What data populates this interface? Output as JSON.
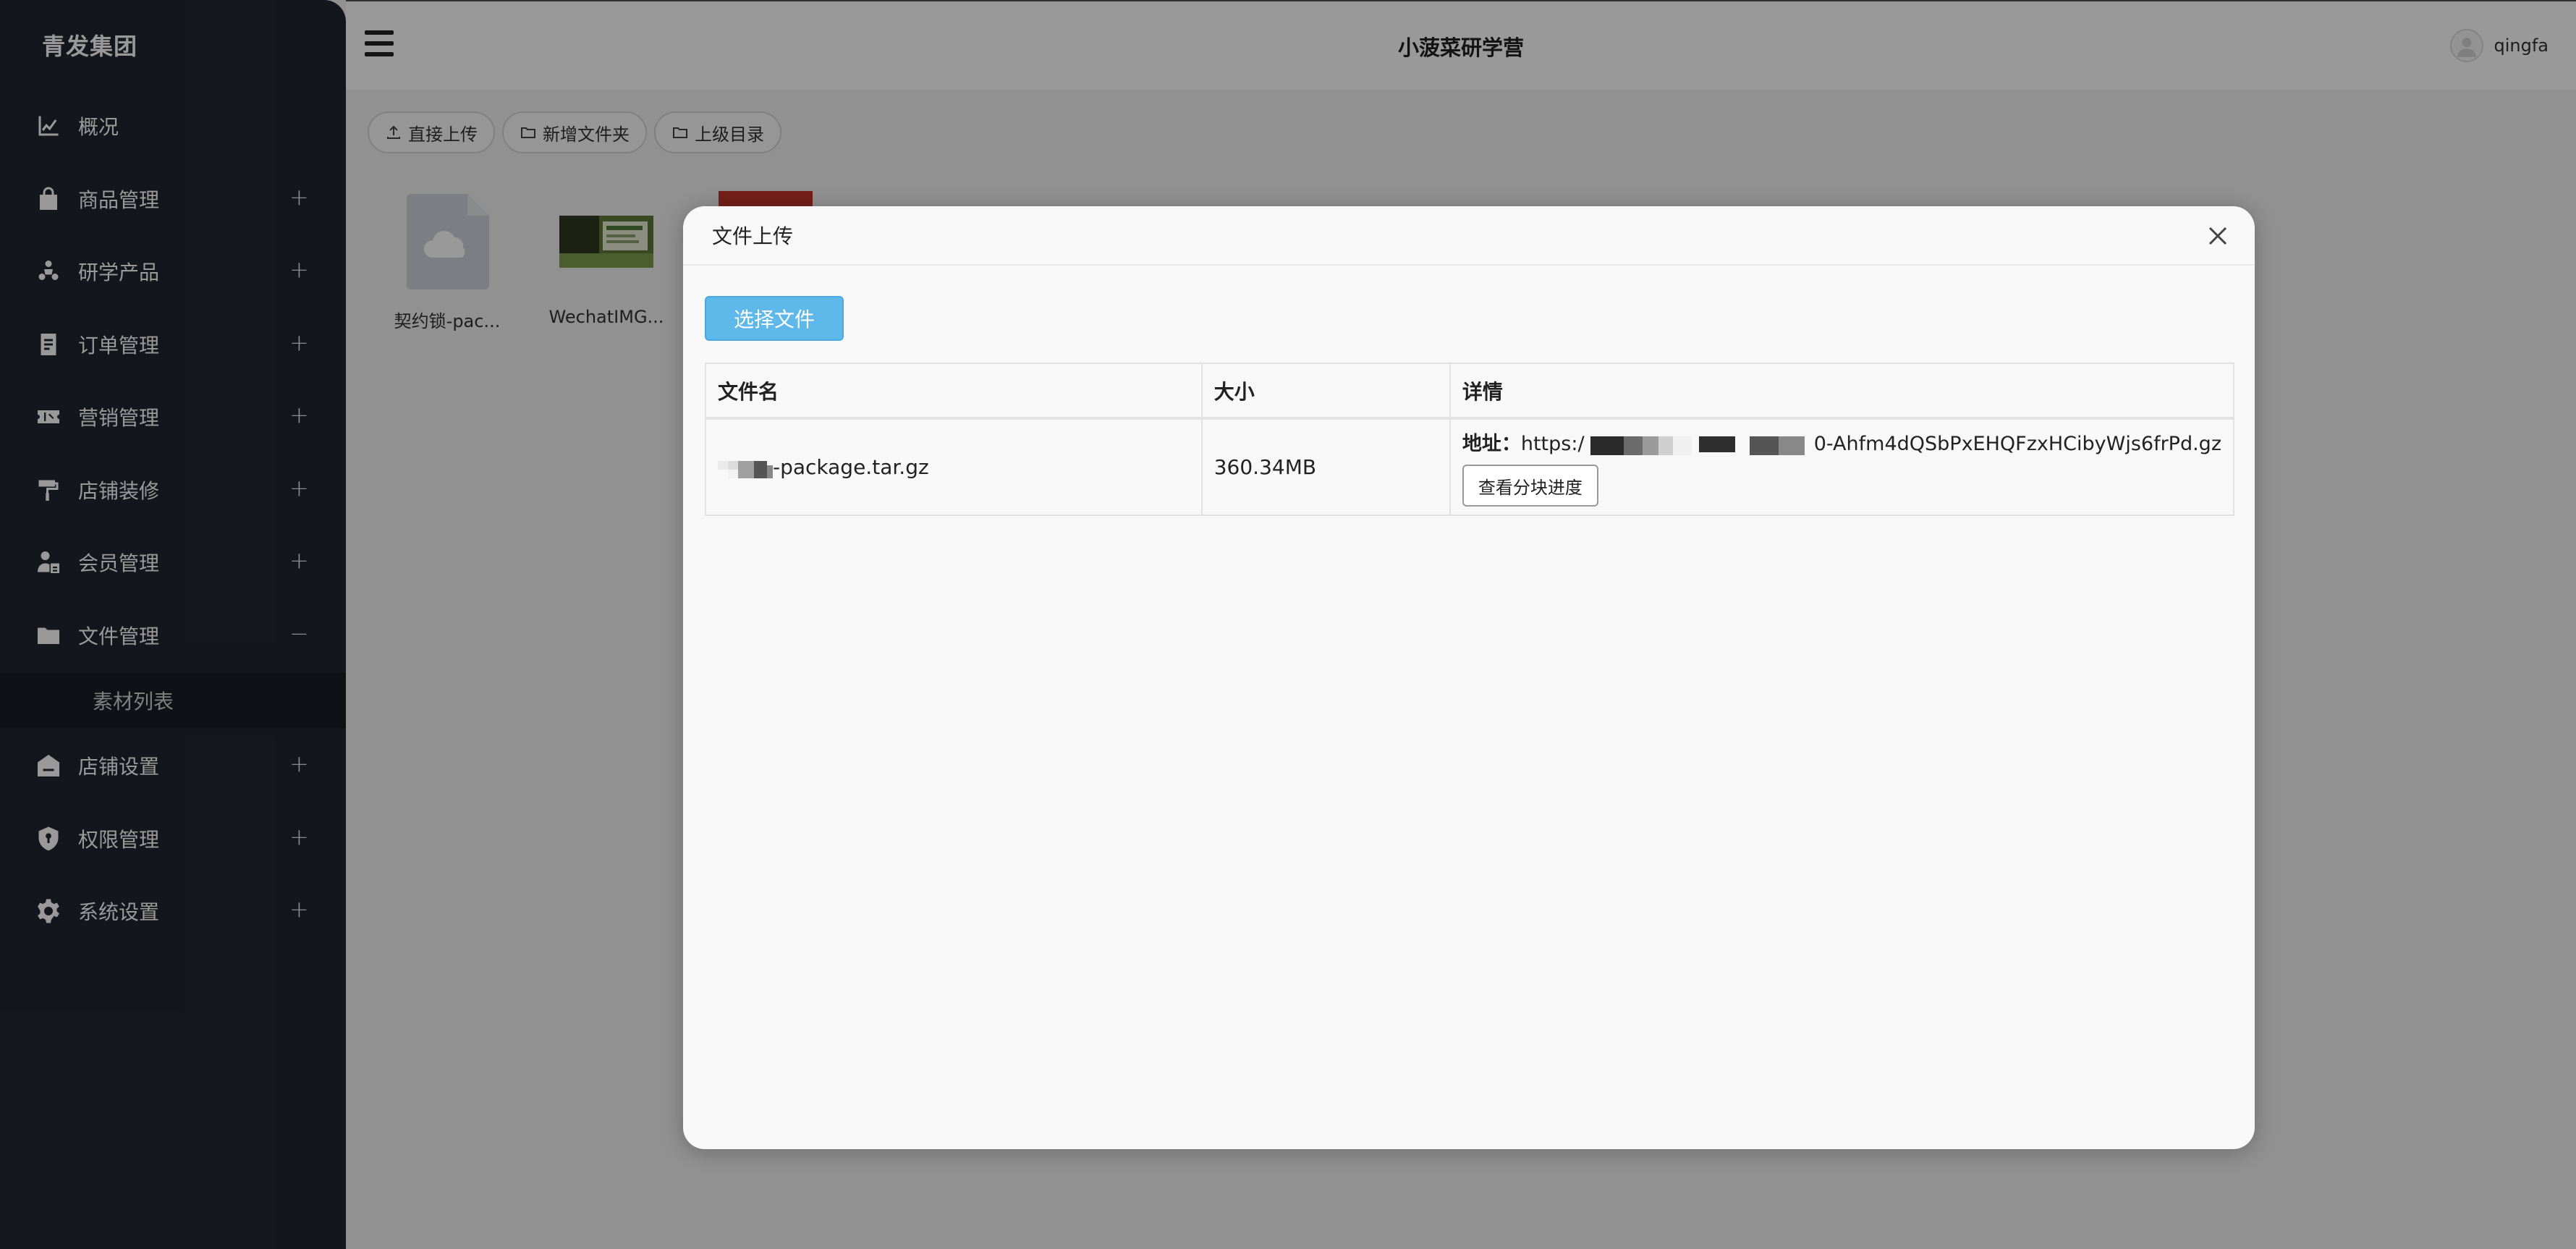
{
  "sidebar": {
    "brand": "青发集团",
    "items": [
      {
        "label": "概况",
        "toggle": ""
      },
      {
        "label": "商品管理",
        "toggle": "+"
      },
      {
        "label": "研学产品",
        "toggle": "+"
      },
      {
        "label": "订单管理",
        "toggle": "+"
      },
      {
        "label": "营销管理",
        "toggle": "+"
      },
      {
        "label": "店铺装修",
        "toggle": "+"
      },
      {
        "label": "会员管理",
        "toggle": "+"
      },
      {
        "label": "文件管理",
        "toggle": "−"
      },
      {
        "label": "店铺设置",
        "toggle": "+"
      },
      {
        "label": "权限管理",
        "toggle": "+"
      },
      {
        "label": "系统设置",
        "toggle": "+"
      }
    ],
    "sub_items": [
      {
        "label": "素材列表"
      }
    ]
  },
  "header": {
    "title": "小菠菜研学营",
    "username": "qingfa"
  },
  "toolbar": {
    "upload": "直接上传",
    "new_folder": "新增文件夹",
    "parent_dir": "上级目录"
  },
  "files": [
    {
      "name": "契约锁-package.tar.gz",
      "display": "契约锁-pac..."
    },
    {
      "name": "WechatIMG...",
      "display": "WechatIMG..."
    }
  ],
  "modal": {
    "title": "文件上传",
    "select_button": "选择文件",
    "columns": [
      "文件名",
      "大小",
      "详情"
    ],
    "rows": [
      {
        "filename_suffix": "-package.tar.gz",
        "size": "360.34MB",
        "detail_label": "地址：",
        "detail_prefix": "https:/",
        "detail_suffix": "0-Ahfm4dQSbPxEHQFzxHCibyWjs6frPd.gz",
        "progress_button": "查看分块进度"
      }
    ]
  },
  "colors": {
    "sidebar_bg": "#222632",
    "primary": "#5fb8ea"
  }
}
